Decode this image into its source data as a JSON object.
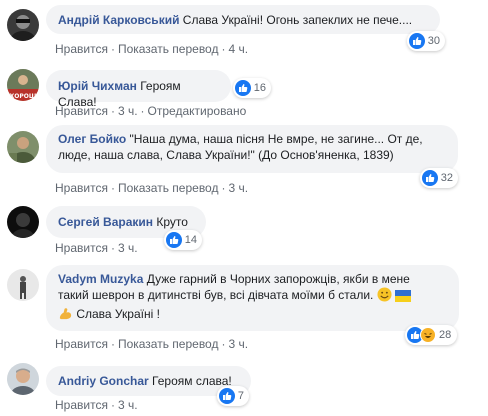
{
  "comments": [
    {
      "author": "Андрій Карковський",
      "text": "Слава Україні! Огонь запеклих не пече....",
      "actions": {
        "like": "Нравится",
        "reply": "Показать перевод",
        "time": "4 ч."
      },
      "reactions": "30"
    },
    {
      "author": "Юрій Чихман",
      "text": "Героям Слава!",
      "actions": {
        "like": "Нравится",
        "time": "3 ч.",
        "edited": "Отредактировано"
      },
      "reactions": "16",
      "avatar_text": "ХОРОШ"
    },
    {
      "author": "Олег Бойко",
      "text": "\"Наша дума, наша пісня Не вмре, не загине... От де, люде, наша слава, Слава України!\" (До Основ'яненка, 1839)",
      "actions": {
        "like": "Нравится",
        "reply": "Показать перевод",
        "time": "3 ч."
      },
      "reactions": "32"
    },
    {
      "author": "Сергей Варакин",
      "text": "Круто",
      "actions": {
        "like": "Нравится",
        "time": "3 ч."
      },
      "reactions": "14"
    },
    {
      "author": "Vadym Muzyka",
      "text_line1": "Дуже гарний в Чорних запорожців, якби в мене",
      "text_line2": "такий шеврон в дитинстві був, всі дівчата моїми б стали.",
      "text_line3": "Слава Україні !",
      "actions": {
        "like": "Нравится",
        "reply": "Показать перевод",
        "time": "3 ч."
      },
      "reactions": "28"
    },
    {
      "author": "Andriy Gonchar",
      "text": "Героям слава!",
      "actions": {
        "like": "Нравится",
        "time": "3 ч."
      },
      "reactions": "7"
    }
  ],
  "colors": {
    "author": "#385898",
    "bubble": "#f2f3f5",
    "like": "#1877f2",
    "meta": "#606770"
  }
}
